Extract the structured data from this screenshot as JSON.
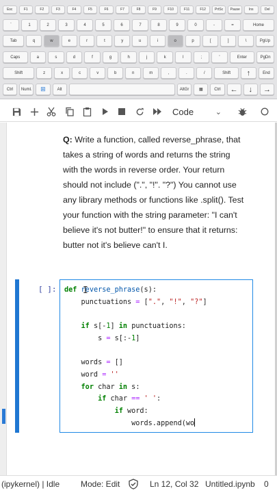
{
  "keyboard": {
    "row1": [
      "Esc",
      "F1",
      "F2",
      "F3",
      "F4",
      "F5",
      "F6",
      "F7",
      "F8",
      "F9",
      "F10",
      "F11",
      "F12",
      "PrtSc",
      "Pause",
      "Ins",
      "Del"
    ],
    "row2": [
      "`",
      "1",
      "2",
      "3",
      "4",
      "5",
      "6",
      "7",
      "8",
      "9",
      "0",
      "-",
      "=",
      "Home"
    ],
    "row3": [
      "Tab",
      "q",
      "w",
      "e",
      "r",
      "t",
      "y",
      "u",
      "i",
      "o",
      "p",
      "[",
      "]",
      "\\",
      "PgUp"
    ],
    "row4": [
      "Caps",
      "a",
      "s",
      "d",
      "f",
      "g",
      "h",
      "j",
      "k",
      "l",
      ";",
      "'",
      "Enter",
      "PgDn"
    ],
    "row5": [
      "Shift",
      "z",
      "x",
      "c",
      "v",
      "b",
      "n",
      "m",
      ",",
      ".",
      "/",
      "Shift",
      "↑",
      "End"
    ],
    "row6": [
      "Ctrl",
      "Numl.",
      "⊞",
      "Alt",
      "",
      "AltGr",
      "▦",
      "Ctrl",
      "←",
      "↓",
      "→"
    ]
  },
  "toolbar": {
    "icons": [
      "save-icon",
      "add-cell-icon",
      "cut-icon",
      "copy-icon",
      "paste-icon",
      "run-icon",
      "stop-icon",
      "restart-icon",
      "fast-forward-icon",
      "debug-icon"
    ],
    "cell_type": "Code"
  },
  "markdown": {
    "q_label": "Q:",
    "text": " Write a function, called reverse_phrase, that takes a string of words and returns the string with the words in reverse order. Your return should not include (\".\", \"!\". \"?\") You cannot use any library methods or functions like .split(). Test your function with the string parameter: \"I can't believe it's not butter!\" to ensure that it returns: butter not it's believe can't I."
  },
  "code_cell": {
    "prompt": "[ ]:",
    "lines": [
      "def reverse_phrase(s):",
      "    punctuations = [\".\", \"!\", \"?\"]",
      "",
      "    if s[-1] in punctuations:",
      "        s = s[:-1]",
      "",
      "    words = []",
      "    word = ''",
      "    for char in s:",
      "        if char == ' ':",
      "            if word:",
      "                words.append(wo"
    ]
  },
  "statusbar": {
    "kernel": "(ipykernel) | Idle",
    "mode": "Mode: Edit",
    "position": "Ln 12, Col 32",
    "filename": "Untitled.ipynb",
    "count": "0"
  }
}
